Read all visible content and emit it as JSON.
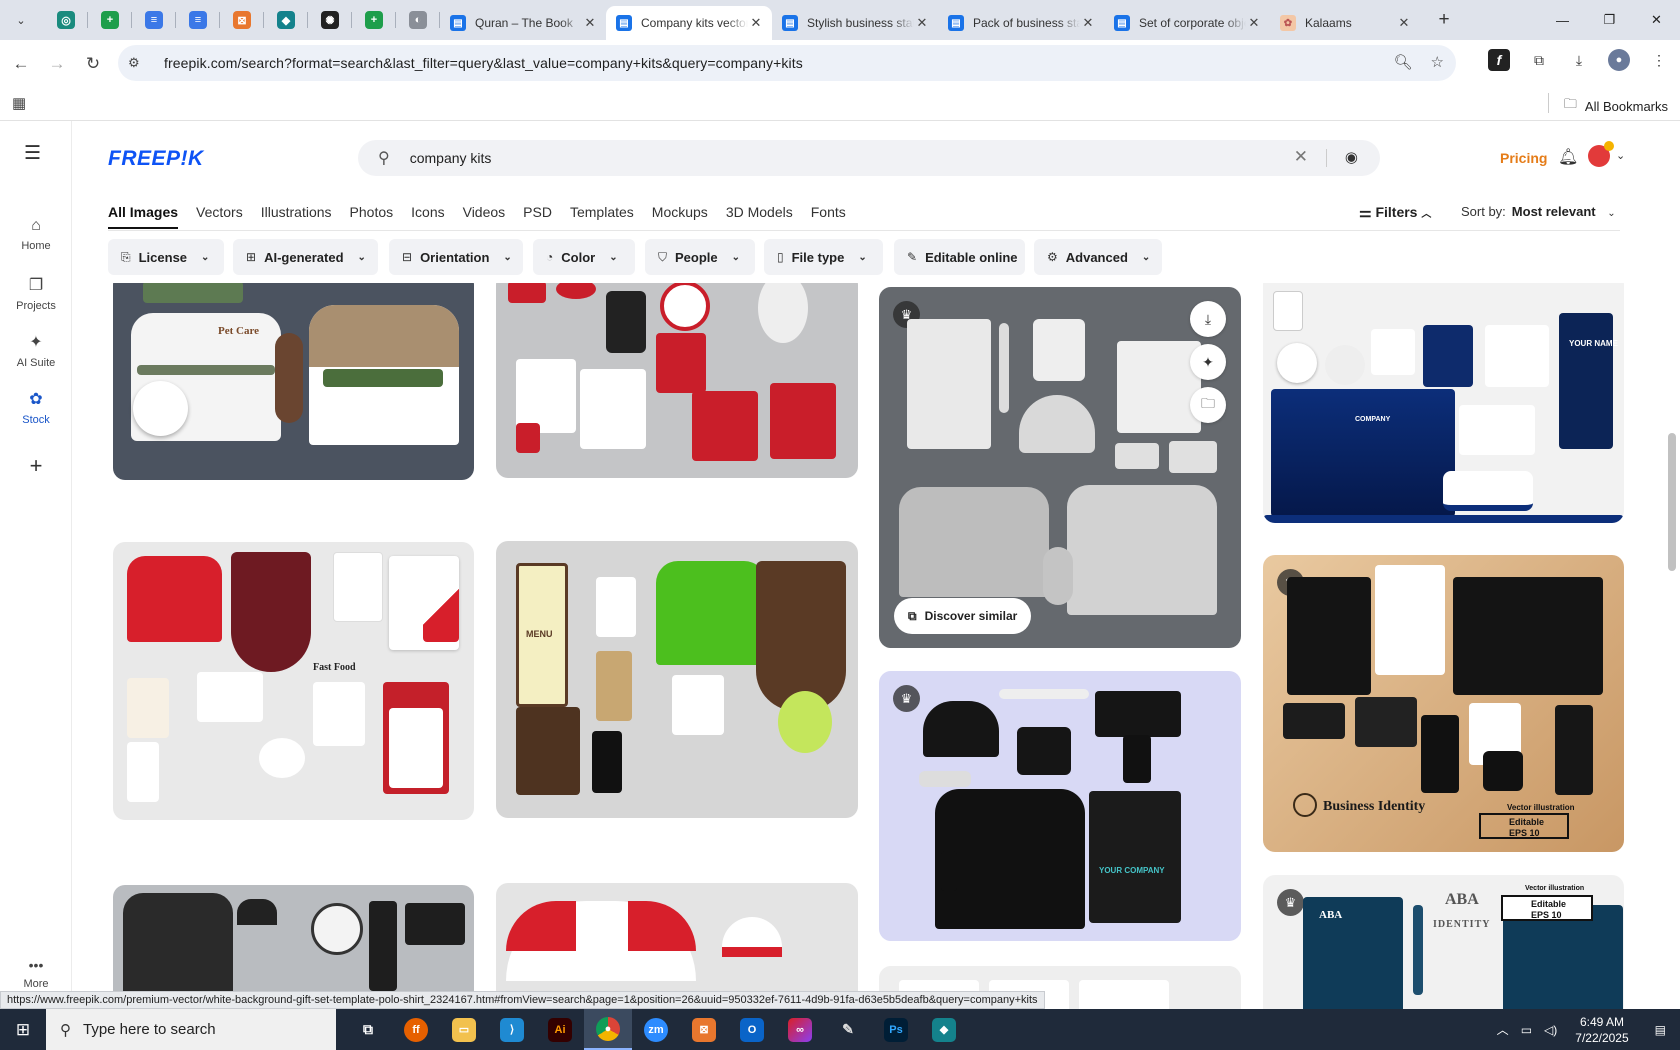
{
  "browser": {
    "tabs": [
      {
        "title": "Quran – The Book",
        "active": false
      },
      {
        "title": "Company kits vectors",
        "active": true
      },
      {
        "title": "Stylish business stationery",
        "active": false
      },
      {
        "title": "Pack of business stationery",
        "active": false
      },
      {
        "title": "Set of corporate objects",
        "active": false
      },
      {
        "title": "Kalaams",
        "active": false
      }
    ],
    "pinned_icons": [
      "vpn-icon",
      "sheets-icon",
      "docs-icon",
      "docs-icon",
      "office-icon",
      "web-app-icon",
      "openai-icon",
      "sheets-icon",
      "globe-icon"
    ],
    "url": "freepik.com/search?format=search&last_filter=query&last_value=company+kits&query=company+kits",
    "bookmarks_label": "All Bookmarks",
    "status_url": "https://www.freepik.com/premium-vector/white-background-gift-set-template-polo-shirt_2324167.htm#fromView=search&page=1&position=26&uuid=950332ef-7611-4d9b-91fa-d63e5b5deafb&query=company+kits"
  },
  "sidebar": {
    "items": [
      {
        "label": "Home",
        "icon": "home-icon"
      },
      {
        "label": "Projects",
        "icon": "projects-icon"
      },
      {
        "label": "AI Suite",
        "icon": "sparkle-icon"
      },
      {
        "label": "Stock",
        "icon": "stock-icon",
        "active": true
      }
    ],
    "more_label": "More"
  },
  "header": {
    "logo": "FREEP!K",
    "search_query": "company kits",
    "pricing_label": "Pricing"
  },
  "categories": {
    "tabs": [
      "All Images",
      "Vectors",
      "Illustrations",
      "Photos",
      "Icons",
      "Videos",
      "PSD",
      "Templates",
      "Mockups",
      "3D Models",
      "Fonts"
    ],
    "active": "All Images",
    "filters_label": "Filters",
    "sort_label": "Sort by:",
    "sort_value": "Most relevant"
  },
  "chips": [
    {
      "label": "License",
      "icon": "license-icon",
      "dropdown": true
    },
    {
      "label": "AI-generated",
      "icon": "ai-icon",
      "dropdown": true
    },
    {
      "label": "Orientation",
      "icon": "orientation-icon",
      "dropdown": true
    },
    {
      "label": "Color",
      "icon": "color-icon",
      "dropdown": true
    },
    {
      "label": "People",
      "icon": "people-icon",
      "dropdown": true
    },
    {
      "label": "File type",
      "icon": "file-icon",
      "dropdown": true
    },
    {
      "label": "Editable online",
      "icon": "pen-icon",
      "dropdown": false
    },
    {
      "label": "Advanced",
      "icon": "gear-icon",
      "dropdown": true
    }
  ],
  "results": {
    "discover_label": "Discover similar",
    "card_texts": {
      "pet_care": "Pet Care",
      "your_name": "YOUR NAME",
      "company": "COMPANY",
      "fast_food": "Fast Food",
      "menu": "MENU",
      "your_company": "YOUR COMPANY",
      "business_identity": "Business Identity",
      "vector_illustration": "Vector illustration",
      "editable": "Editable",
      "eps": "EPS 10",
      "aba": "ABA",
      "student_identity": "IDENTITY"
    }
  },
  "taskbar": {
    "search_placeholder": "Type here to search",
    "time": "6:49 AM",
    "date": "7/22/2025"
  },
  "colors": {
    "brand": "#0e53f5",
    "pricing": "#e57c18",
    "active_sidebar": "#1a56c9"
  }
}
